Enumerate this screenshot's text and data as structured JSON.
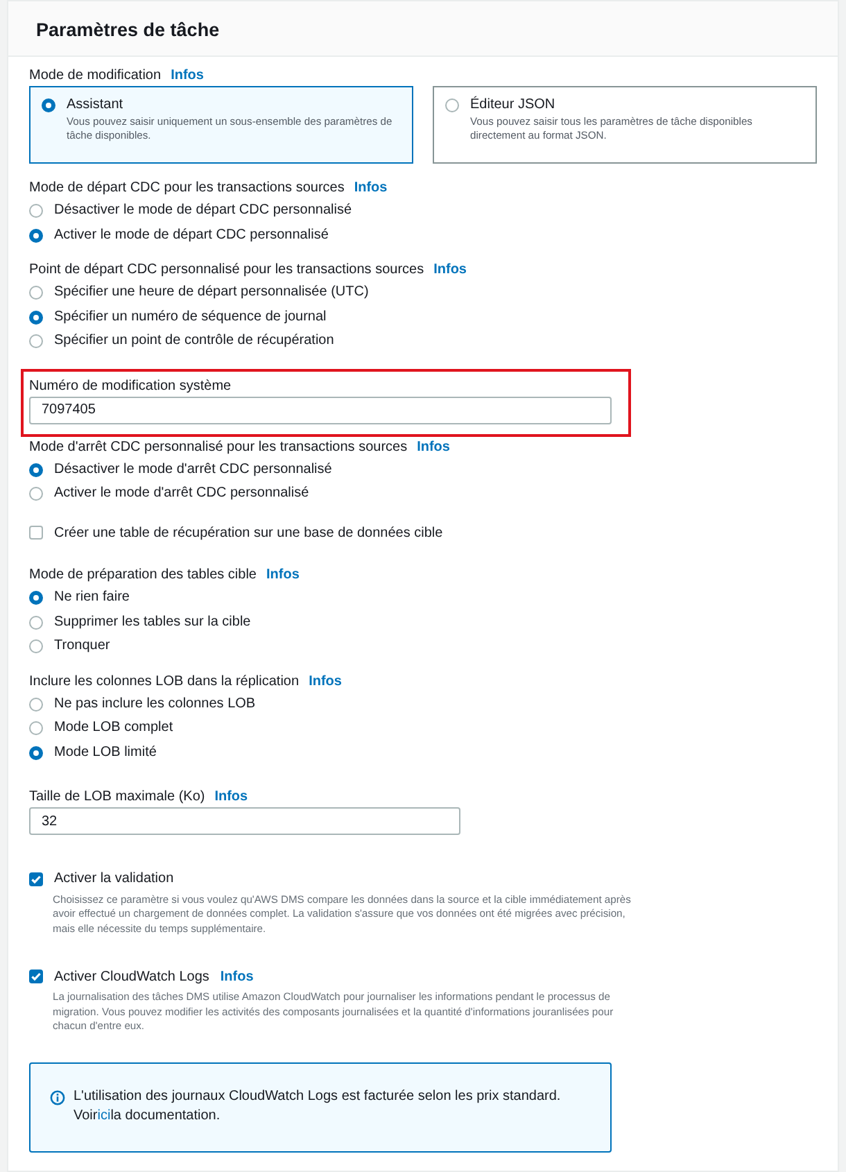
{
  "panel": {
    "title": "Paramètres de tâche"
  },
  "sections": [
    {
      "kind": "tiles",
      "label": "Mode de modification",
      "info": "Infos",
      "tiles": [
        {
          "title": "Assistant",
          "description": "Vous pouvez saisir uniquement un sous-ensemble des paramètres de tâche disponibles.",
          "selected": true
        },
        {
          "title": "Éditeur JSON",
          "description": "Vous pouvez saisir tous les paramètres de tâche disponibles directement au format JSON.",
          "selected": false
        }
      ]
    },
    {
      "kind": "radio",
      "label": "Mode de départ CDC pour les transactions sources",
      "info": "Infos",
      "options": [
        {
          "label": "Désactiver le mode de départ CDC personnalisé",
          "selected": false
        },
        {
          "label": "Activer le mode de départ CDC personnalisé",
          "selected": true
        }
      ]
    },
    {
      "kind": "radio",
      "label": "Point de départ CDC personnalisé pour les transactions sources",
      "info": "Infos",
      "options": [
        {
          "label": "Spécifier une heure de départ personnalisée (UTC)",
          "selected": false
        },
        {
          "label": "Spécifier un numéro de séquence de journal",
          "selected": true
        },
        {
          "label": "Spécifier un point de contrôle de récupération",
          "selected": false
        }
      ]
    },
    {
      "kind": "field",
      "label": "Numéro de modification système",
      "value": "7097405",
      "highlighted": true
    },
    {
      "kind": "radio",
      "label": "Mode d'arrêt CDC personnalisé pour les transactions sources",
      "info": "Infos",
      "options": [
        {
          "label": "Désactiver le mode d'arrêt CDC personnalisé",
          "selected": true
        },
        {
          "label": "Activer le mode d'arrêt CDC personnalisé",
          "selected": false
        }
      ]
    },
    {
      "kind": "checkbox",
      "label": "Créer une table de récupération sur une base de données cible",
      "checked": false
    },
    {
      "kind": "radio",
      "label": "Mode de préparation des tables cible",
      "info": "Infos",
      "options": [
        {
          "label": "Ne rien faire",
          "selected": true
        },
        {
          "label": "Supprimer les tables sur la cible",
          "selected": false
        },
        {
          "label": "Tronquer",
          "selected": false
        }
      ]
    },
    {
      "kind": "radio",
      "label": "Inclure les colonnes LOB dans la réplication",
      "info": "Infos",
      "options": [
        {
          "label": "Ne pas inclure les colonnes LOB",
          "selected": false
        },
        {
          "label": "Mode LOB complet",
          "selected": false
        },
        {
          "label": "Mode LOB limité",
          "selected": true
        }
      ]
    },
    {
      "kind": "field",
      "label": "Taille de LOB maximale (Ko)",
      "info": "Infos",
      "value": "32",
      "highlighted": false
    },
    {
      "kind": "checkbox",
      "label": "Activer la validation",
      "checked": true,
      "description": "Choisissez ce paramètre si vous voulez qu'AWS DMS compare les données dans la source et la cible immédiatement après avoir effectué un chargement de données complet. La validation s'assure que vos données ont été migrées avec précision, mais elle nécessite du temps supplémentaire."
    },
    {
      "kind": "checkbox",
      "label": "Activer CloudWatch Logs",
      "info": "Infos",
      "checked": true,
      "description": "La journalisation des tâches DMS utilise Amazon CloudWatch pour journaliser les informations pendant le processus de migration. Vous pouvez modifier les activités des composants journalisées et la quantité d'informations jouranlisées pour chacun d'entre eux."
    },
    {
      "kind": "alert",
      "text": "L'utilisation des journaux CloudWatch Logs est facturée selon les prix standard.",
      "link_before": "Voir",
      "link": "ici",
      "link_after": "la documentation."
    }
  ]
}
